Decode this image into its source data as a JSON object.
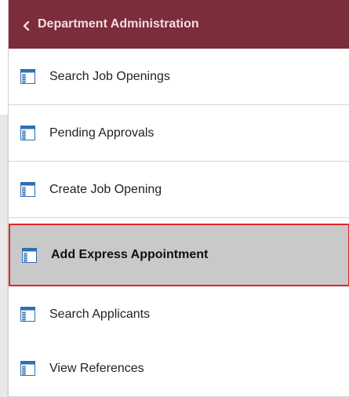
{
  "header": {
    "back_label": "Department Administration"
  },
  "menu": {
    "items": [
      {
        "label": "Search Job Openings",
        "selected": false
      },
      {
        "label": "Pending Approvals",
        "selected": false
      },
      {
        "label": "Create Job Opening",
        "selected": false
      },
      {
        "label": "Add Express Appointment",
        "selected": true
      },
      {
        "label": "Search Applicants",
        "selected": false
      },
      {
        "label": "View References",
        "selected": false
      }
    ]
  },
  "colors": {
    "header_bg": "#7b2d3b",
    "selected_bg": "#c9c9c9",
    "selected_border": "#e0262b",
    "icon_blue": "#2d6fb3"
  },
  "icons": {
    "back": "chevron-left-icon",
    "item": "page-icon"
  }
}
